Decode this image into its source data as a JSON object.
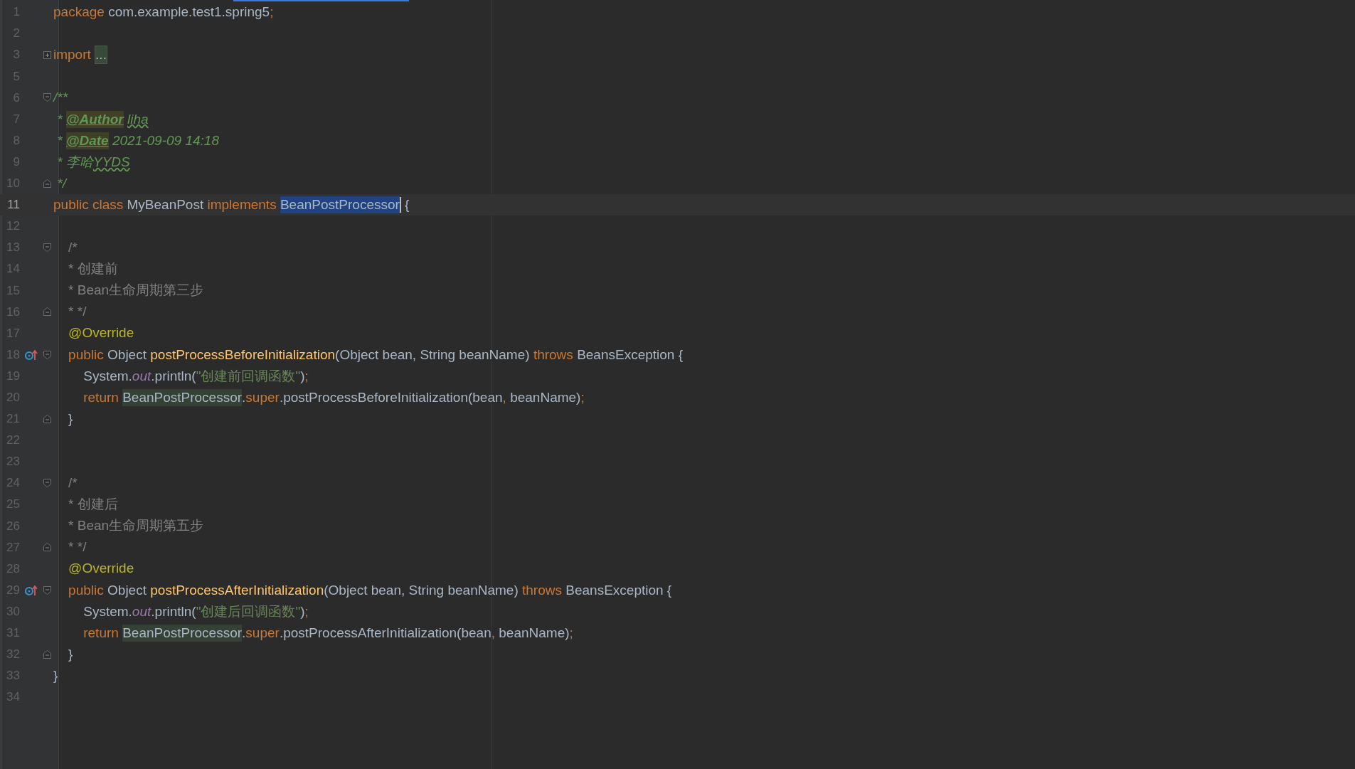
{
  "editor": {
    "lines": [
      {
        "number": "1",
        "current": false,
        "tokens": [
          {
            "text": "package ",
            "kind": "keyword"
          },
          {
            "text": "com.example.test1.spring5",
            "kind": "plain"
          },
          {
            "text": ";",
            "kind": "punct"
          }
        ]
      },
      {
        "number": "2",
        "current": false
      },
      {
        "number": "3",
        "current": false,
        "collapsed": true,
        "tokens": [
          {
            "text": "import ",
            "kind": "keyword"
          },
          {
            "text": "...",
            "kind": "folded"
          }
        ]
      },
      {
        "number": "5",
        "current": false
      },
      {
        "number": "6",
        "current": false,
        "fold_open": true,
        "tokens": [
          {
            "text": "/**",
            "kind": "doc"
          }
        ]
      },
      {
        "number": "7",
        "current": false,
        "tokens": [
          {
            "text": " * ",
            "kind": "doc"
          },
          {
            "text": "@Author",
            "kind": "doctag"
          },
          {
            "text": " liha",
            "kind": "typo"
          }
        ]
      },
      {
        "number": "8",
        "current": false,
        "tokens": [
          {
            "text": " * ",
            "kind": "doc"
          },
          {
            "text": "@Date",
            "kind": "doctag"
          },
          {
            "text": " 2021-09-09 14:18",
            "kind": "doc"
          }
        ]
      },
      {
        "number": "9",
        "current": false,
        "tokens": [
          {
            "text": " * 李哈",
            "kind": "doc"
          },
          {
            "text": "YYDS",
            "kind": "typo"
          }
        ]
      },
      {
        "number": "10",
        "current": false,
        "fold_close": true,
        "tokens": [
          {
            "text": " */",
            "kind": "doc"
          }
        ]
      },
      {
        "number": "11",
        "current": true,
        "tokens": [
          {
            "text": "public class ",
            "kind": "keyword"
          },
          {
            "text": "MyBeanPost ",
            "kind": "plain"
          },
          {
            "text": "implements ",
            "kind": "keyword"
          },
          {
            "text": "BeanPostProcessor",
            "kind": "selected",
            "caret": true
          },
          {
            "text": " {",
            "kind": "plain"
          }
        ]
      },
      {
        "number": "12",
        "current": false
      },
      {
        "number": "13",
        "current": false,
        "fold_open": true,
        "tokens": [
          {
            "text": "    /*",
            "kind": "comment"
          }
        ]
      },
      {
        "number": "14",
        "current": false,
        "tokens": [
          {
            "text": "    * 创建前",
            "kind": "comment"
          }
        ]
      },
      {
        "number": "15",
        "current": false,
        "tokens": [
          {
            "text": "    * Bean生命周期第三步",
            "kind": "comment"
          }
        ]
      },
      {
        "number": "16",
        "current": false,
        "fold_close": true,
        "tokens": [
          {
            "text": "    * */",
            "kind": "comment"
          }
        ]
      },
      {
        "number": "17",
        "current": false,
        "tokens": [
          {
            "text": "    @Override",
            "kind": "annotation"
          }
        ]
      },
      {
        "number": "18",
        "current": false,
        "override": true,
        "fold_open": true,
        "tokens": [
          {
            "text": "    public ",
            "kind": "keyword"
          },
          {
            "text": "Object ",
            "kind": "plain"
          },
          {
            "text": "postProcessBeforeInitialization",
            "kind": "method"
          },
          {
            "text": "(Object bean, String beanName) ",
            "kind": "plain"
          },
          {
            "text": "throws ",
            "kind": "keyword"
          },
          {
            "text": "BeansException {",
            "kind": "plain"
          }
        ]
      },
      {
        "number": "19",
        "current": false,
        "tokens": [
          {
            "text": "        System.",
            "kind": "plain"
          },
          {
            "text": "out",
            "kind": "field"
          },
          {
            "text": ".println(",
            "kind": "plain"
          },
          {
            "text": "\"创建前回调函数\"",
            "kind": "string"
          },
          {
            "text": ")",
            "kind": "plain"
          },
          {
            "text": ";",
            "kind": "punct"
          }
        ]
      },
      {
        "number": "20",
        "current": false,
        "tokens": [
          {
            "text": "        return ",
            "kind": "keyword"
          },
          {
            "text": "BeanPostProcessor",
            "kind": "ref"
          },
          {
            "text": ".",
            "kind": "plain"
          },
          {
            "text": "super",
            "kind": "keyword"
          },
          {
            "text": ".postProcessBeforeInitialization(bean",
            "kind": "plain"
          },
          {
            "text": ",",
            "kind": "punct"
          },
          {
            "text": " beanName)",
            "kind": "plain"
          },
          {
            "text": ";",
            "kind": "punct"
          }
        ]
      },
      {
        "number": "21",
        "current": false,
        "fold_close": true,
        "tokens": [
          {
            "text": "    }",
            "kind": "plain"
          }
        ]
      },
      {
        "number": "22",
        "current": false
      },
      {
        "number": "23",
        "current": false
      },
      {
        "number": "24",
        "current": false,
        "fold_open": true,
        "tokens": [
          {
            "text": "    /*",
            "kind": "comment"
          }
        ]
      },
      {
        "number": "25",
        "current": false,
        "tokens": [
          {
            "text": "    * 创建后",
            "kind": "comment"
          }
        ]
      },
      {
        "number": "26",
        "current": false,
        "tokens": [
          {
            "text": "    * Bean生命周期第五步",
            "kind": "comment"
          }
        ]
      },
      {
        "number": "27",
        "current": false,
        "fold_close": true,
        "tokens": [
          {
            "text": "    * */",
            "kind": "comment"
          }
        ]
      },
      {
        "number": "28",
        "current": false,
        "tokens": [
          {
            "text": "    @Override",
            "kind": "annotation"
          }
        ]
      },
      {
        "number": "29",
        "current": false,
        "override": true,
        "fold_open": true,
        "tokens": [
          {
            "text": "    public ",
            "kind": "keyword"
          },
          {
            "text": "Object ",
            "kind": "plain"
          },
          {
            "text": "postProcessAfterInitialization",
            "kind": "method"
          },
          {
            "text": "(Object bean, String beanName) ",
            "kind": "plain"
          },
          {
            "text": "throws ",
            "kind": "keyword"
          },
          {
            "text": "BeansException {",
            "kind": "plain"
          }
        ]
      },
      {
        "number": "30",
        "current": false,
        "tokens": [
          {
            "text": "        System.",
            "kind": "plain"
          },
          {
            "text": "out",
            "kind": "field"
          },
          {
            "text": ".println(",
            "kind": "plain"
          },
          {
            "text": "\"创建后回调函数\"",
            "kind": "string"
          },
          {
            "text": ")",
            "kind": "plain"
          },
          {
            "text": ";",
            "kind": "punct"
          }
        ]
      },
      {
        "number": "31",
        "current": false,
        "tokens": [
          {
            "text": "        return ",
            "kind": "keyword"
          },
          {
            "text": "BeanPostProcessor",
            "kind": "ref"
          },
          {
            "text": ".",
            "kind": "plain"
          },
          {
            "text": "super",
            "kind": "keyword"
          },
          {
            "text": ".postProcessAfterInitialization(bean",
            "kind": "plain"
          },
          {
            "text": ",",
            "kind": "punct"
          },
          {
            "text": " beanName)",
            "kind": "plain"
          },
          {
            "text": ";",
            "kind": "punct"
          }
        ]
      },
      {
        "number": "32",
        "current": false,
        "fold_close": true,
        "tokens": [
          {
            "text": "    }",
            "kind": "plain"
          }
        ]
      },
      {
        "number": "33",
        "current": false,
        "tokens": [
          {
            "text": "}",
            "kind": "plain"
          }
        ]
      },
      {
        "number": "34",
        "current": false
      }
    ]
  }
}
